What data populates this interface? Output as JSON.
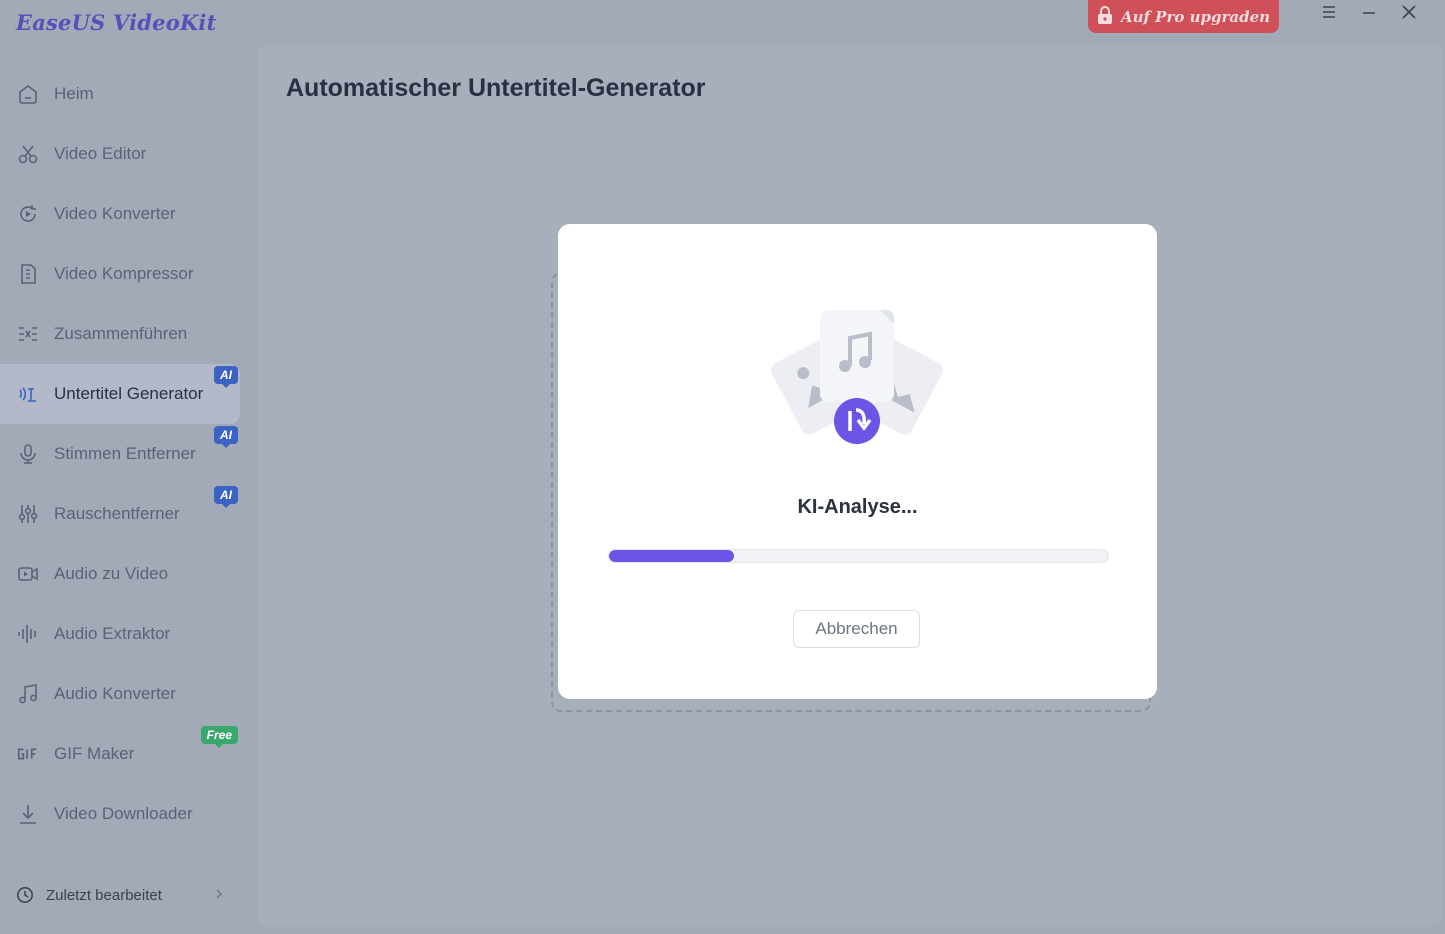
{
  "app": {
    "title": "EaseUS VideoKit"
  },
  "header": {
    "upgrade_label": "Auf Pro upgraden"
  },
  "sidebar": {
    "items": [
      {
        "label": "Heim",
        "icon": "home-icon"
      },
      {
        "label": "Video Editor",
        "icon": "scissors-icon"
      },
      {
        "label": "Video Konverter",
        "icon": "convert-icon"
      },
      {
        "label": "Video Kompressor",
        "icon": "compress-icon"
      },
      {
        "label": "Zusammenführen",
        "icon": "merge-icon"
      },
      {
        "label": "Untertitel Generator",
        "icon": "subtitle-icon",
        "badge": "AI",
        "active": true
      },
      {
        "label": "Stimmen Entferner",
        "icon": "microphone-icon",
        "badge": "AI"
      },
      {
        "label": "Rauschentferner",
        "icon": "sliders-icon",
        "badge": "AI"
      },
      {
        "label": "Audio zu Video",
        "icon": "video-icon"
      },
      {
        "label": "Audio Extraktor",
        "icon": "waveform-icon"
      },
      {
        "label": "Audio Konverter",
        "icon": "music-note-icon"
      },
      {
        "label": "GIF Maker",
        "icon": "gif-icon",
        "badge": "Free"
      },
      {
        "label": "Video Downloader",
        "icon": "download-icon"
      }
    ],
    "recent_label": "Zuletzt bearbeitet"
  },
  "main": {
    "title": "Automatischer Untertitel-Generator"
  },
  "dialog": {
    "status_text": "KI-Analyse...",
    "progress_fraction": 0.25,
    "cancel_label": "Abbrechen"
  },
  "colors": {
    "accent": "#6b55e6",
    "upgrade": "#cf5058",
    "badge_ai": "#3a63c4",
    "badge_free": "#3aa76d"
  }
}
